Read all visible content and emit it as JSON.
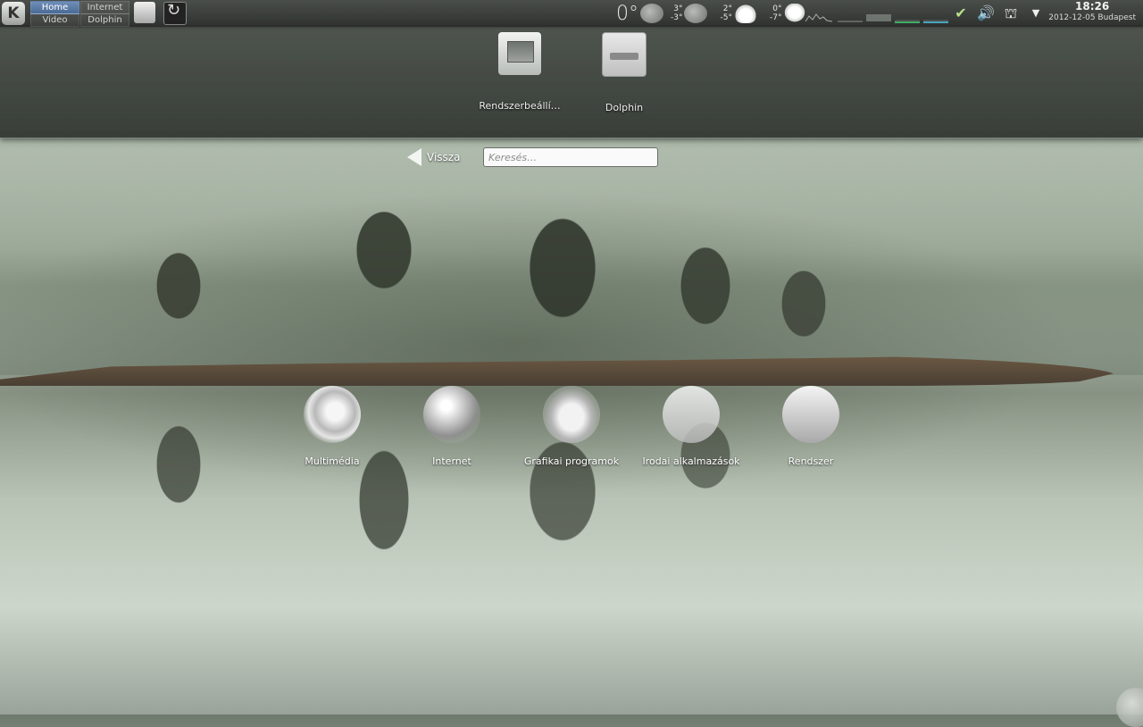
{
  "panel": {
    "pager": [
      "Home",
      "Internet",
      "Video",
      "Dolphin"
    ],
    "weather": {
      "current": "0°",
      "day1": {
        "hi": "3°",
        "lo": "-3°"
      },
      "day2": {
        "hi": "2°",
        "lo": "-5°"
      },
      "day3": {
        "hi": "0°",
        "lo": "-7°"
      }
    },
    "clock": {
      "time": "18:26",
      "date": "2012-12-05 Budapest"
    }
  },
  "favorites": [
    {
      "label": "Rendszerbeállí…",
      "icon": "system-settings-icon"
    },
    {
      "label": "Dolphin",
      "icon": "dolphin-file-manager-icon"
    }
  ],
  "launcher": {
    "back_label": "Vissza",
    "search_placeholder": "Keresés…"
  },
  "categories": [
    {
      "label": "Multimédia",
      "icon": "multimedia-icon"
    },
    {
      "label": "Internet",
      "icon": "internet-globe-icon"
    },
    {
      "label": "Grafikai programok",
      "icon": "graphics-icon"
    },
    {
      "label": "Irodai alkalmazások",
      "icon": "office-icon"
    },
    {
      "label": "Rendszer",
      "icon": "system-icon"
    }
  ]
}
